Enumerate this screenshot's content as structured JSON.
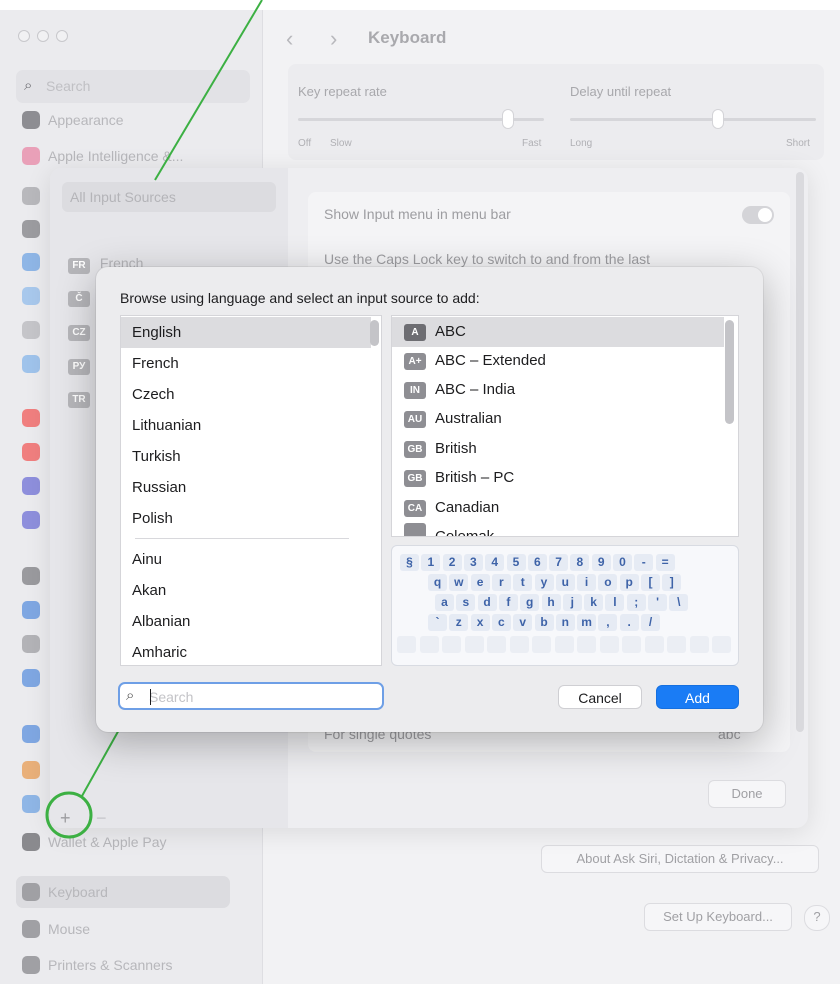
{
  "window": {
    "title": "Keyboard",
    "sidebar": {
      "search_placeholder": "Search",
      "top_items": [
        "Appearance",
        "Apple Intelligence &..."
      ],
      "bottom_items": [
        "Wallet & Apple Pay",
        "Keyboard",
        "Mouse",
        "Printers & Scanners"
      ]
    },
    "key_repeat": {
      "label": "Key repeat rate",
      "left_labels": [
        "Off",
        "Slow"
      ],
      "right_label": "Fast"
    },
    "delay_repeat": {
      "label": "Delay until repeat",
      "left_label": "Long",
      "right_label": "Short"
    },
    "buttons": {
      "about_siri": "About Ask Siri, Dictation & Privacy...",
      "set_up_keyboard": "Set Up Keyboard...",
      "help": "?"
    }
  },
  "input_sources_sheet": {
    "all_sources": "All Input Sources",
    "sources": [
      {
        "badge": "FR",
        "label": "French"
      },
      {
        "badge": "Č",
        "label": ""
      },
      {
        "badge": "CZ",
        "label": ""
      },
      {
        "badge": "РУ",
        "label": ""
      },
      {
        "badge": "TR",
        "label": ""
      }
    ],
    "show_menu_label": "Show Input menu in menu bar",
    "caps_lock_label": "Use the Caps Lock key to switch to and from the last",
    "single_quotes_label": "For single quotes",
    "single_quotes_value": "abc",
    "add_symbol": "+",
    "remove_symbol": "−",
    "done": "Done"
  },
  "dialog": {
    "title": "Browse using language and select an input source to add:",
    "languages_top": [
      "English",
      "French",
      "Czech",
      "Lithuanian",
      "Turkish",
      "Russian",
      "Polish"
    ],
    "languages_all": [
      "Ainu",
      "Akan",
      "Albanian",
      "Amharic"
    ],
    "sources": [
      {
        "badge": "A",
        "label": "ABC"
      },
      {
        "badge": "A+",
        "label": "ABC – Extended"
      },
      {
        "badge": "IN",
        "label": "ABC – India"
      },
      {
        "badge": "AU",
        "label": "Australian"
      },
      {
        "badge": "GB",
        "label": "British"
      },
      {
        "badge": "GB",
        "label": "British – PC"
      },
      {
        "badge": "CA",
        "label": "Canadian"
      },
      {
        "badge": "",
        "label": "Colemak"
      }
    ],
    "keyboard_rows": [
      [
        "§",
        "1",
        "2",
        "3",
        "4",
        "5",
        "6",
        "7",
        "8",
        "9",
        "0",
        "-",
        "="
      ],
      [
        "q",
        "w",
        "e",
        "r",
        "t",
        "y",
        "u",
        "i",
        "o",
        "p",
        "[",
        "]"
      ],
      [
        "a",
        "s",
        "d",
        "f",
        "g",
        "h",
        "j",
        "k",
        "l",
        ";",
        "'",
        "\\"
      ],
      [
        "`",
        "z",
        "x",
        "c",
        "v",
        "b",
        "n",
        "m",
        ",",
        ".",
        "/"
      ]
    ],
    "search_placeholder": "Search",
    "search_value": "",
    "cancel": "Cancel",
    "add": "Add"
  },
  "colors": {
    "accent": "#1a7cf5",
    "annotation": "#3cb043"
  }
}
